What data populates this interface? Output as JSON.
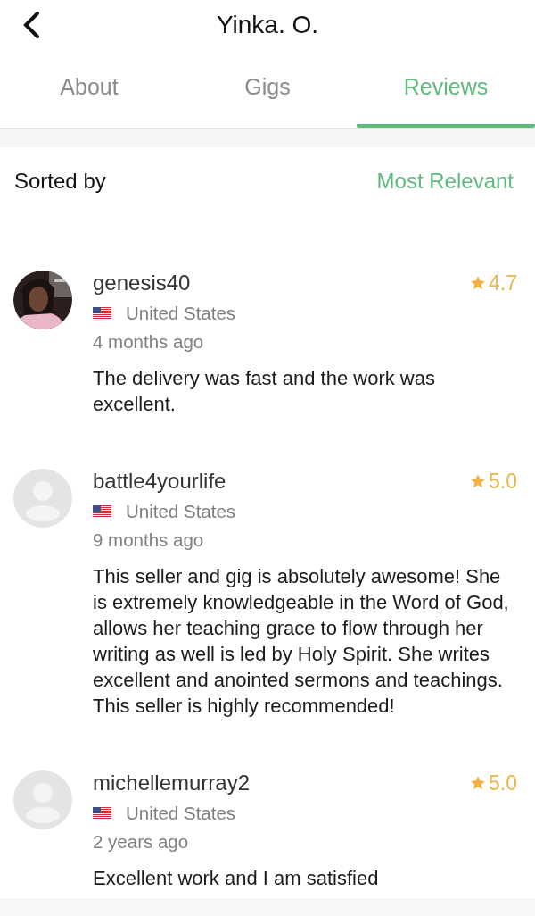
{
  "header": {
    "title": "Yinka. O."
  },
  "tabs": [
    {
      "label": "About",
      "selected": false
    },
    {
      "label": "Gigs",
      "selected": false
    },
    {
      "label": "Reviews",
      "selected": true
    }
  ],
  "sort": {
    "label": "Sorted by",
    "value": "Most Relevant"
  },
  "reviews": [
    {
      "username": "genesis40",
      "country": "United States",
      "time": "4 months ago",
      "rating": "4.7",
      "text": "The delivery was fast and the work was excellent."
    },
    {
      "avatar": {
        "kind": "placeholder"
      },
      "username": "battle4yourlife",
      "country": "United States",
      "time": "9 months ago",
      "rating": "5.0",
      "text": "This seller and gig is absolutely awesome! She is extremely knowledgeable in the Word of God, allows her teaching grace to flow through her writing as well is led by Holy Spirit. She writes excellent and anointed sermons and teachings. This seller is highly recommended!"
    },
    {
      "avatar": {
        "kind": "placeholder"
      },
      "username": "michellemurray2",
      "country": "United States",
      "time": "2 years ago",
      "rating": "5.0",
      "text": "Excellent work and I am satisfied"
    }
  ]
}
